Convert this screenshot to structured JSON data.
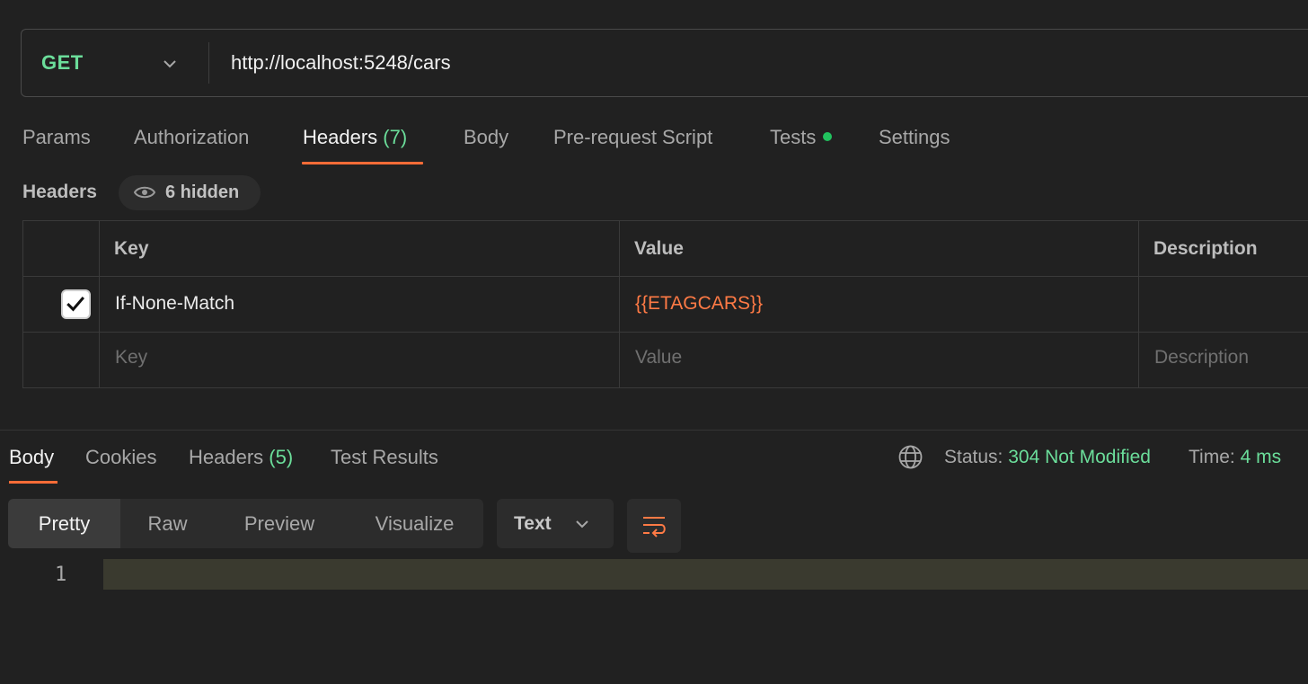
{
  "request": {
    "method": "GET",
    "url": "http://localhost:5248/cars"
  },
  "request_tabs": [
    {
      "label": "Params"
    },
    {
      "label": "Authorization"
    },
    {
      "label": "Headers",
      "count": "(7)",
      "active": true
    },
    {
      "label": "Body"
    },
    {
      "label": "Pre-request Script"
    },
    {
      "label": "Tests",
      "indicator": "green-dot"
    },
    {
      "label": "Settings"
    }
  ],
  "headers_section": {
    "title": "Headers",
    "hidden_label": "6 hidden",
    "columns": [
      "Key",
      "Value",
      "Description"
    ],
    "rows": [
      {
        "checked": true,
        "key": "If-None-Match",
        "value": "{{ETAGCARS}}",
        "description": ""
      }
    ],
    "placeholders": {
      "key": "Key",
      "value": "Value",
      "description": "Description"
    }
  },
  "response_tabs": [
    {
      "label": "Body",
      "active": true
    },
    {
      "label": "Cookies"
    },
    {
      "label": "Headers",
      "count": "(5)"
    },
    {
      "label": "Test Results"
    }
  ],
  "response_status": {
    "status_label": "Status:",
    "status_value": "304 Not Modified",
    "time_label": "Time:",
    "time_value": "4 ms"
  },
  "format_toolbar": {
    "modes": [
      "Pretty",
      "Raw",
      "Preview",
      "Visualize"
    ],
    "active_mode": "Pretty",
    "content_type": "Text"
  },
  "editor": {
    "line_numbers": [
      "1"
    ]
  },
  "colors": {
    "accent": "#ff6c37",
    "method_get": "#6bdd9a",
    "status_ok": "#6bdd9a",
    "variable": "#ff7a45",
    "background": "#212121"
  },
  "icons": {
    "method_dropdown": "chevron-down-icon",
    "hidden_toggle": "eye-icon",
    "network": "globe-icon",
    "format_dropdown": "chevron-down-icon",
    "wrap": "wrap-lines-icon"
  }
}
